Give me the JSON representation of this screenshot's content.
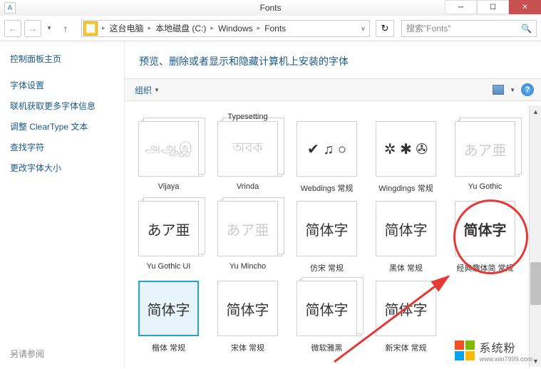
{
  "window": {
    "title": "Fonts",
    "icon_letter": "A"
  },
  "nav": {
    "breadcrumb": [
      "这台电脑",
      "本地磁盘 (C:)",
      "Windows",
      "Fonts"
    ],
    "search_placeholder": "搜索\"Fonts\""
  },
  "sidebar": {
    "home": "控制面板主页",
    "links": [
      "字体设置",
      "联机获取更多字体信息",
      "调整 ClearType 文本",
      "查找字符",
      "更改字体大小"
    ],
    "footer": "另请参阅"
  },
  "content": {
    "header": "预览、删除或者显示和隐藏计算机上安装的字体",
    "toolbar": {
      "organize": "组织"
    }
  },
  "fonts": [
    {
      "name": "Typesetting",
      "preview": "",
      "stack": false,
      "faded": false,
      "half_top": true
    },
    {
      "name": "Vijaya",
      "preview": "அஆஇ",
      "stack": true,
      "faded": true
    },
    {
      "name": "Vrinda",
      "preview": "অবক",
      "stack": true,
      "faded": true
    },
    {
      "name": "Webdings 常规",
      "preview": "✔ ♫ ○",
      "stack": false,
      "faded": false
    },
    {
      "name": "Wingdings 常规",
      "preview": "✲ ✱ ✇",
      "stack": false,
      "faded": false
    },
    {
      "name": "Yu Gothic",
      "preview": "あア亜",
      "stack": true,
      "faded": true
    },
    {
      "name": "Yu Gothic UI",
      "preview": "あア亜",
      "stack": true,
      "faded": false
    },
    {
      "name": "Yu Mincho",
      "preview": "あア亜",
      "stack": true,
      "faded": true
    },
    {
      "name": "仿宋 常规",
      "preview": "简体字",
      "stack": false,
      "faded": false
    },
    {
      "name": "黑体 常规",
      "preview": "简体字",
      "stack": false,
      "faded": false
    },
    {
      "name": "经典趣体简 常规",
      "preview": "简体字",
      "stack": false,
      "faded": false,
      "bold_style": true
    },
    {
      "name": "楷体 常规",
      "preview": "简体字",
      "stack": false,
      "faded": false,
      "selected": true
    },
    {
      "name": "宋体 常规",
      "preview": "简体字",
      "stack": false,
      "faded": false
    },
    {
      "name": "微软雅黑",
      "preview": "简体字",
      "stack": true,
      "faded": false
    },
    {
      "name": "新宋体 常规",
      "preview": "简体字",
      "stack": false,
      "faded": false
    }
  ],
  "watermark": {
    "text": "系统粉",
    "sub": "www.win7999.com"
  }
}
